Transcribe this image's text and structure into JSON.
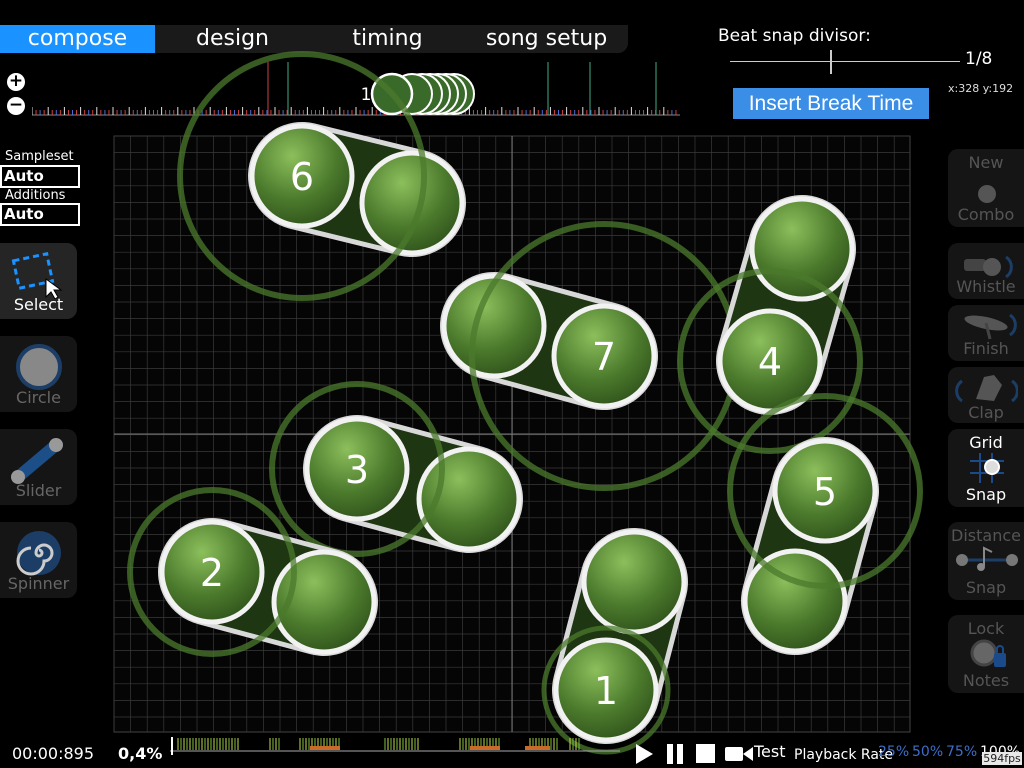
{
  "tabs": [
    "compose",
    "design",
    "timing",
    "song setup"
  ],
  "active_tab": "compose",
  "beat_snap": {
    "label": "Beat snap divisor:",
    "value": "1/8"
  },
  "coords": "x:328 y:192",
  "insert_break_label": "Insert Break Time",
  "sampleset": {
    "label": "Sampleset",
    "value": "Auto",
    "additions_label": "Additions",
    "additions_value": "Auto"
  },
  "tools": [
    {
      "label": "Select",
      "icon": "select-icon",
      "selected": true
    },
    {
      "label": "Circle",
      "icon": "circle-icon",
      "selected": false
    },
    {
      "label": "Slider",
      "icon": "slider-icon",
      "selected": false
    },
    {
      "label": "Spinner",
      "icon": "spinner-icon",
      "selected": false
    }
  ],
  "right_buttons": {
    "new_combo": [
      "New",
      "Combo"
    ],
    "whistle": "Whistle",
    "finish": "Finish",
    "clap": "Clap",
    "grid_snap": [
      "Grid",
      "Snap"
    ],
    "distance_snap": [
      "Distance",
      "Snap"
    ],
    "lock_notes": [
      "Lock",
      "Notes"
    ]
  },
  "timeline_marker_number": "1",
  "hit_objects": [
    "1",
    "2",
    "3",
    "4",
    "5",
    "6",
    "7"
  ],
  "colors": {
    "accent": "#1a92ff",
    "object_green": "#4b7a2c",
    "break_button": "#3a8ee6"
  },
  "bottom": {
    "time": "00:00:895",
    "progress": "0,4%",
    "test_label": "Test",
    "playback_rate_label": "Playback Rate",
    "rates": [
      "25%",
      "50%",
      "75%",
      "100%"
    ],
    "fps": "594fps"
  }
}
